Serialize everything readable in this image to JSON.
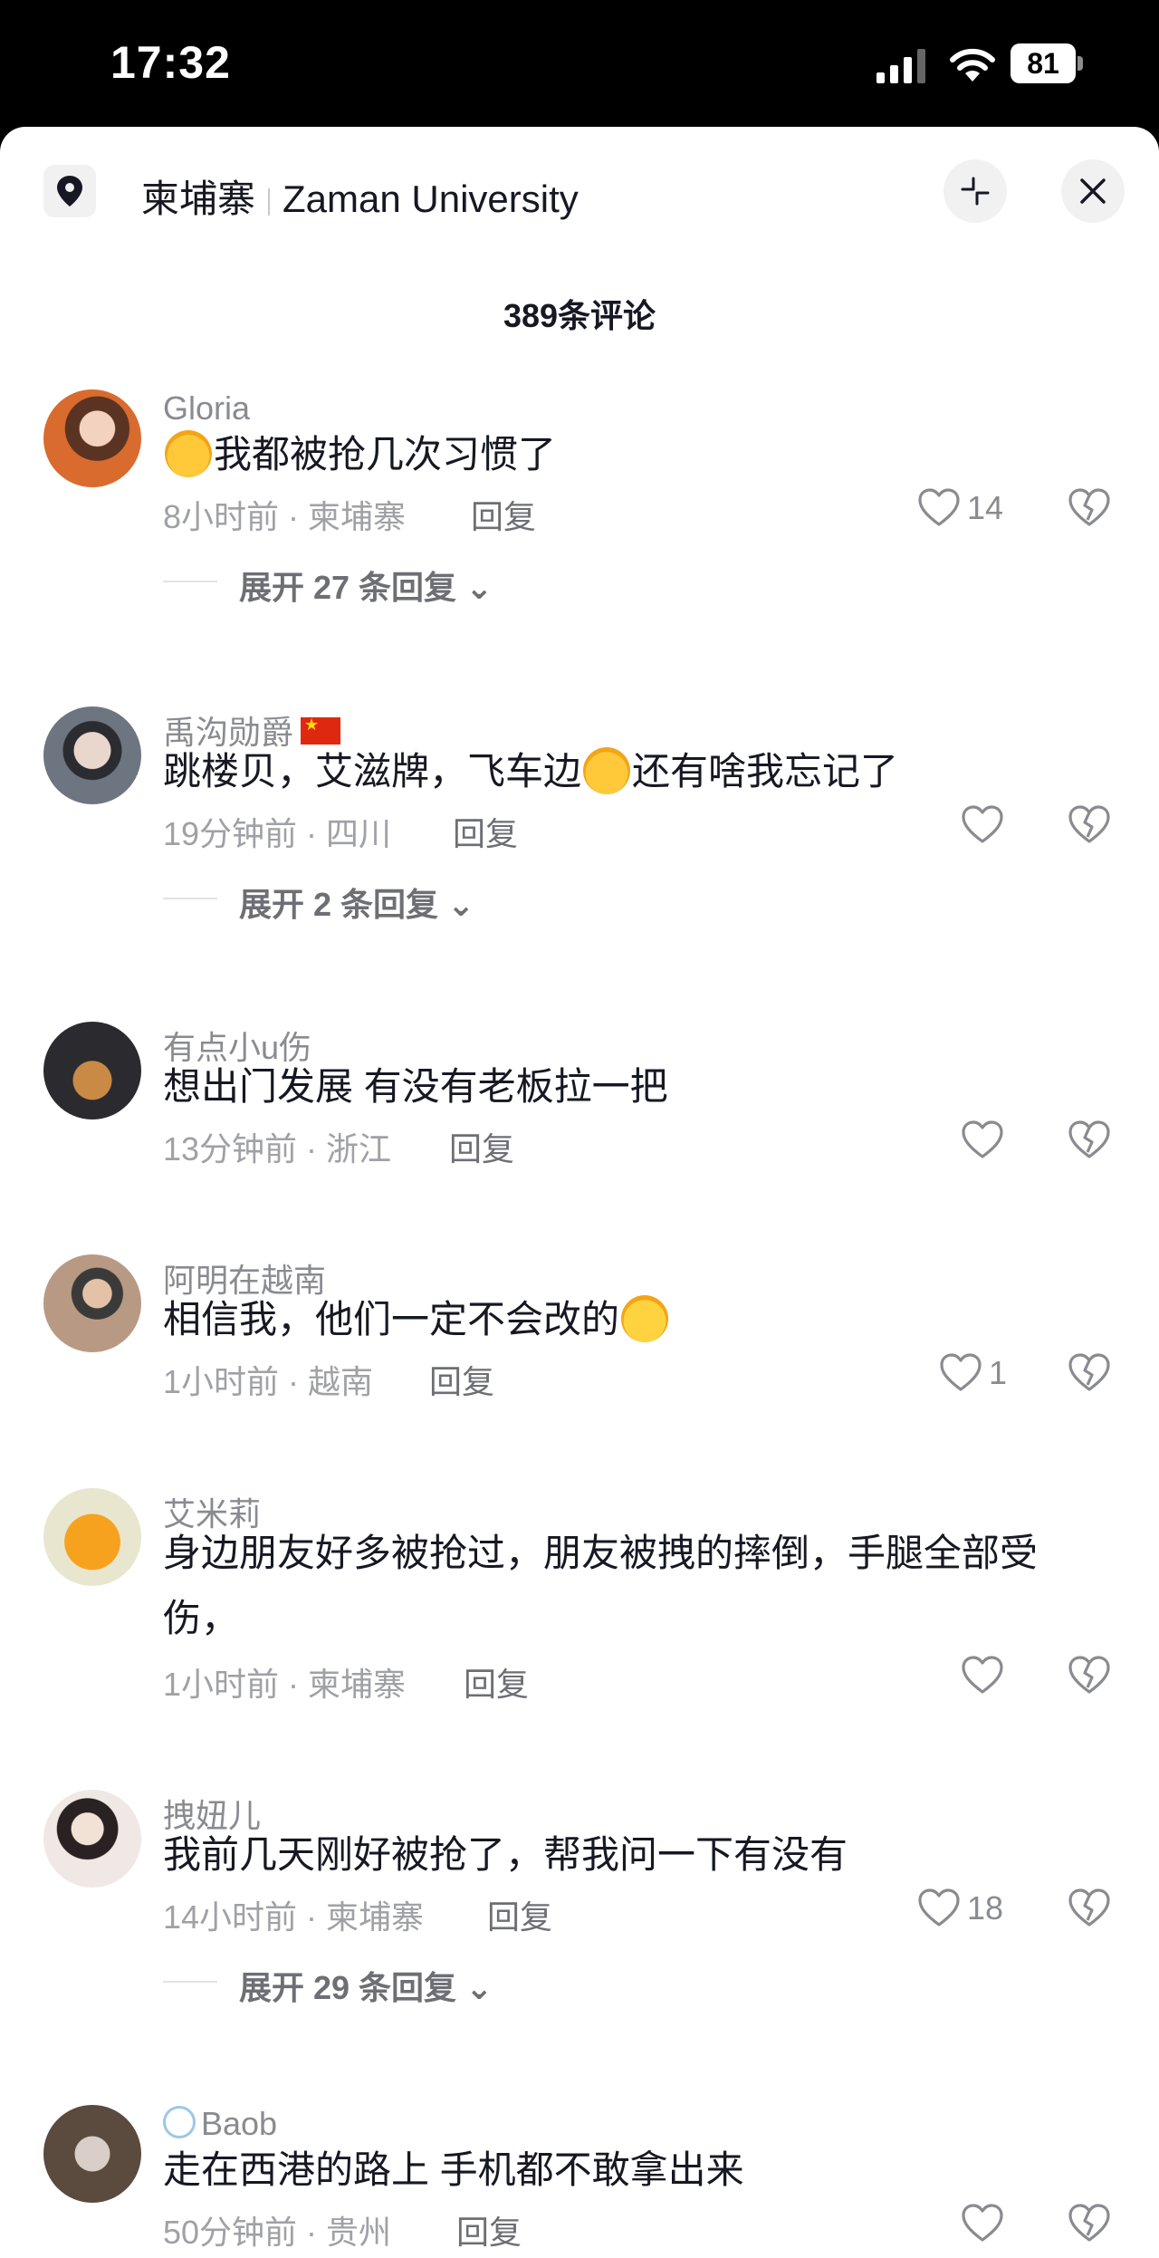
{
  "status_bar": {
    "time": "17:32",
    "battery": "81"
  },
  "header": {
    "location": "柬埔寨",
    "place": "Zaman University"
  },
  "comment_count": "389条评论",
  "reply_label": "回复",
  "comments": [
    {
      "user": "Gloria",
      "text": "我都被抢几次习惯了",
      "meta": "8小时前 · 柬埔寨",
      "likes": "14",
      "expand": "展开 27 条回复",
      "emoji": "rolling-laughing",
      "avatar_color": "#d8845a"
    },
    {
      "user": "禹沟勋爵",
      "text_before": "跳楼贝，艾滋牌，飞车边",
      "text_after": "还有啥我忘记了",
      "meta": "19分钟前 · 四川",
      "likes": "",
      "expand": "展开 2 条回复",
      "flag": "china-flag",
      "avatar_color": "#3b3f46"
    },
    {
      "user": "有点小u伤",
      "text": "想出门发展  有没有老板拉一把",
      "meta": "13分钟前 · 浙江",
      "likes": "",
      "avatar_color": "#4a3b2c"
    },
    {
      "user": "阿明在越南",
      "text": "相信我，他们一定不会改的",
      "meta": "1小时前 · 越南",
      "likes": "1",
      "emoji": "grinning",
      "avatar_color": "#9a7e6a"
    },
    {
      "user": "艾米莉",
      "text": "身边朋友好多被抢过，朋友被拽的摔倒，手腿全部受伤，",
      "meta": "1小时前 · 柬埔寨",
      "likes": "",
      "avatar_color": "#f29b28"
    },
    {
      "user": "拽妞儿",
      "text": "我前几天刚好被抢了，帮我问一下有没有",
      "meta": "14小时前 · 柬埔寨",
      "likes": "18",
      "expand": "展开 29 条回复",
      "avatar_color": "#e9e2dc"
    },
    {
      "user": "Baob",
      "text": "走在西港的路上 手机都不敢拿出来",
      "meta": "50分钟前 · 贵州",
      "likes": "",
      "avatar_color": "#6d5a4c"
    }
  ]
}
